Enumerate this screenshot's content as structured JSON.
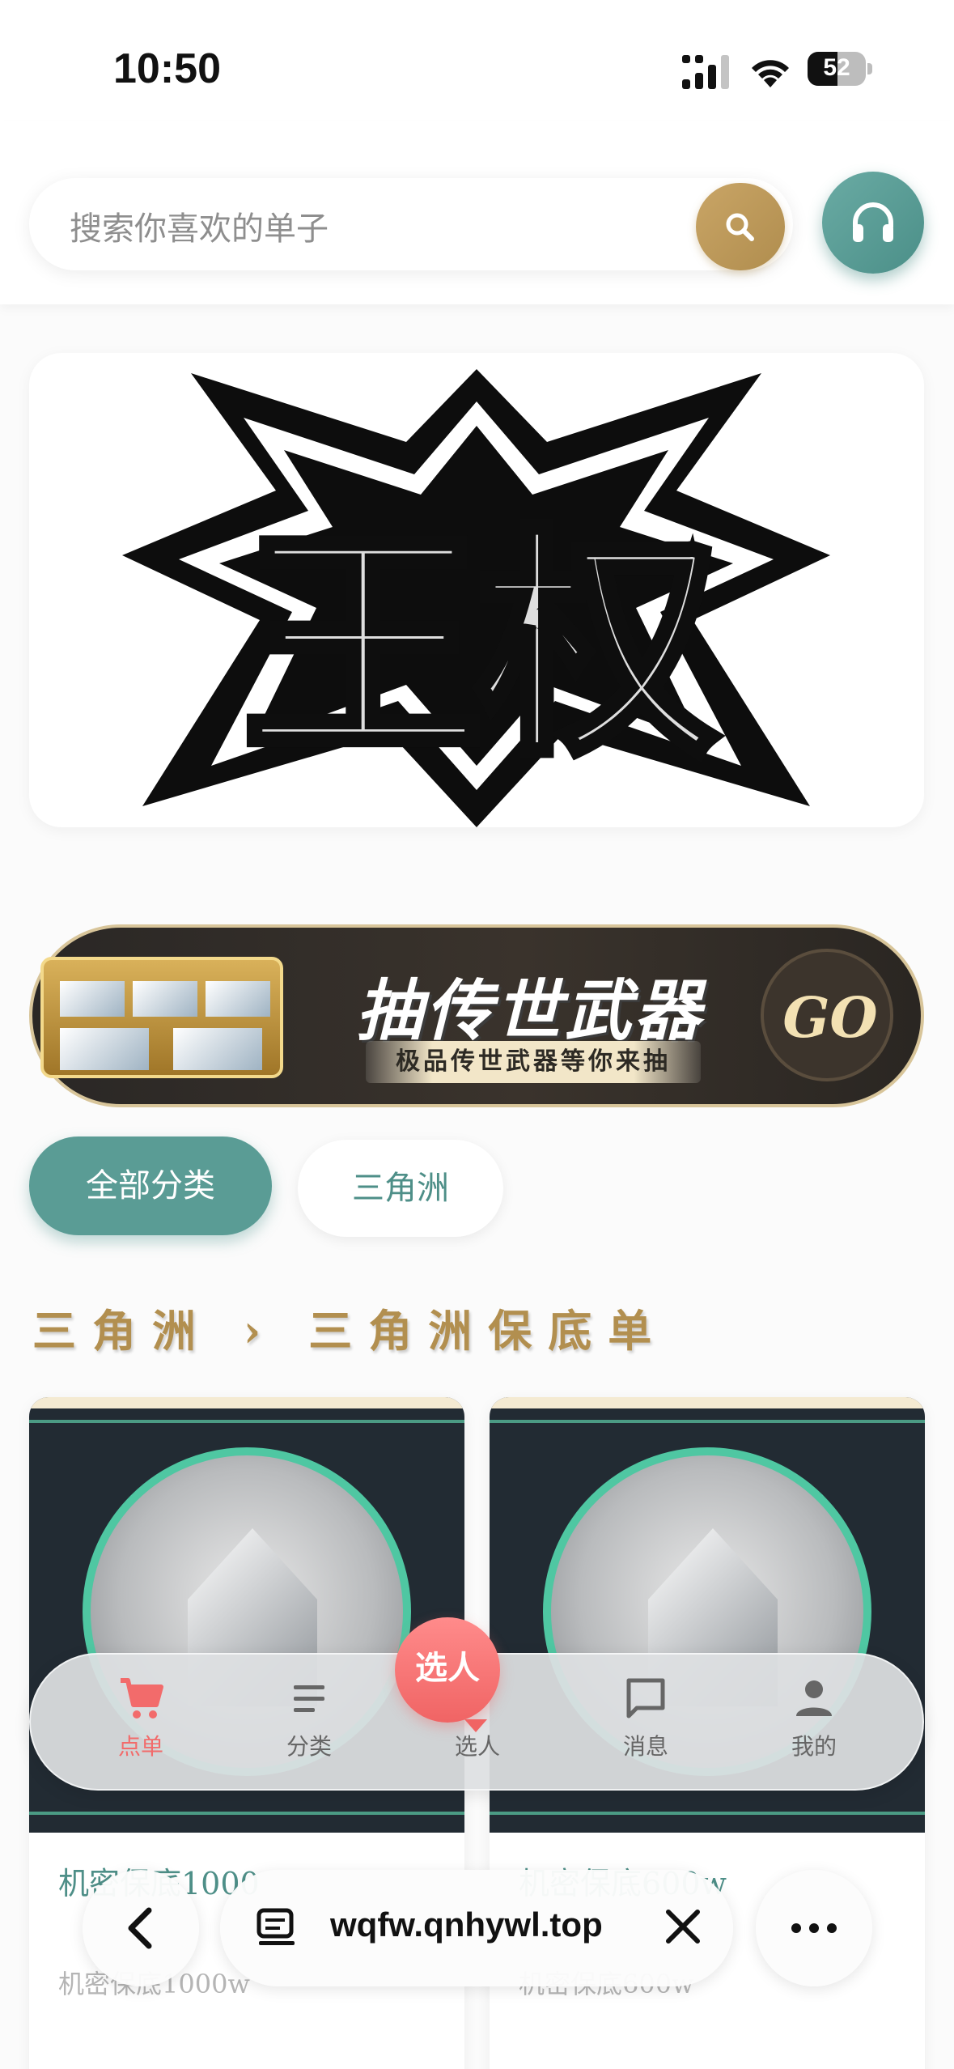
{
  "status_bar": {
    "time": "10:50",
    "battery": "52"
  },
  "search": {
    "placeholder": "搜索你喜欢的单子"
  },
  "main_banner": {
    "logo_text": "王权"
  },
  "promo": {
    "title": "抽传世武器",
    "subtitle": "极品传世武器等你来抽",
    "go": "GO"
  },
  "categories": [
    {
      "label": "全部分类",
      "active": true
    },
    {
      "label": "三角洲",
      "active": false
    }
  ],
  "section": {
    "title": "三角洲 › 三角洲保底单"
  },
  "products": [
    {
      "title": "机密保底1000",
      "subtitle": "机密保底1000w"
    },
    {
      "title": "机密保底600w",
      "subtitle": "机密保底600w"
    }
  ],
  "tabbar": {
    "items": [
      {
        "label": "点单",
        "icon": "cart-icon",
        "active": true
      },
      {
        "label": "分类",
        "icon": "list-icon",
        "active": false
      },
      {
        "label": "选人",
        "icon": "pick-icon",
        "active": false
      },
      {
        "label": "消息",
        "icon": "message-icon",
        "active": false
      },
      {
        "label": "我的",
        "icon": "user-icon",
        "active": false
      }
    ],
    "pick_bubble": "选人",
    "active_color": "#f26b6b"
  },
  "browser": {
    "url": "wqfw.qnhywl.top"
  },
  "colors": {
    "accent": "#5a9c95",
    "gold": "#b28f4f",
    "highlight": "#f26b6b"
  }
}
